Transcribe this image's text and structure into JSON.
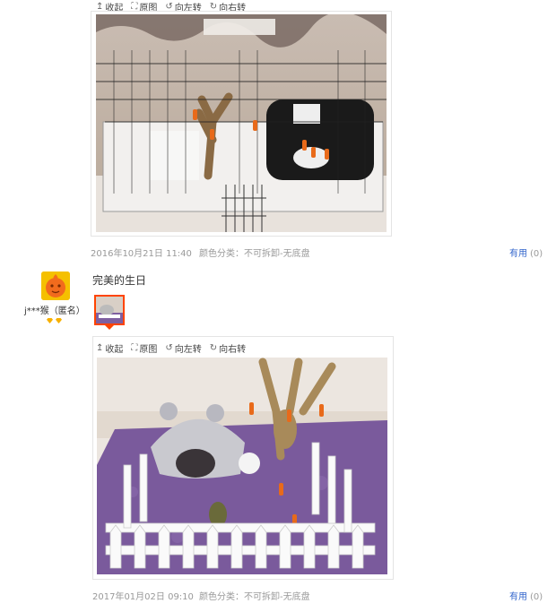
{
  "toolbar": {
    "collapse_label": "收起",
    "original_label": "原图",
    "rotate_left_label": "向左转",
    "rotate_right_label": "向右转"
  },
  "reviews": [
    {
      "date": "2016年10月21日 11:40",
      "spec": "颜色分类：不可拆卸-无底盘",
      "useful_label": "有用",
      "useful_count": "(0)"
    },
    {
      "username": "j***猴（匿名）",
      "comment": "完美的生日",
      "date": "2017年01月02日 09:10",
      "spec": "颜色分类：不可拆卸-无底盘",
      "useful_label": "有用",
      "useful_count": "(0)"
    }
  ],
  "colors": {
    "link": "#3366cc",
    "accent": "#ff4400",
    "meta_text": "#999999"
  },
  "icons": [
    "collapse-icon",
    "fullscreen-icon",
    "rotate-left-icon",
    "rotate-right-icon",
    "user-avatar",
    "vip-badge-icon"
  ]
}
